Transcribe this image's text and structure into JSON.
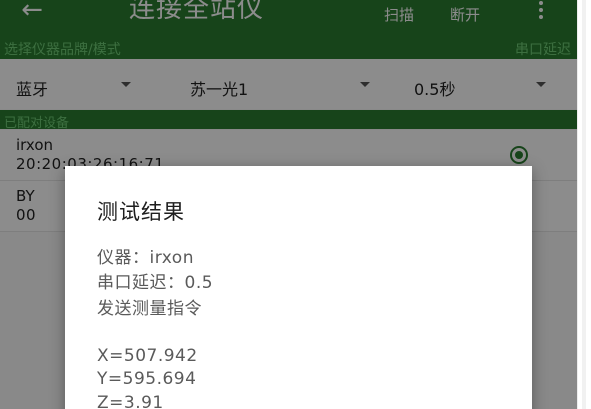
{
  "appbar": {
    "title": "连接全站仪",
    "scan_label": "扫描",
    "disconnect_label": "断开"
  },
  "subheader": {
    "left_label": "选择仪器品牌/模式",
    "right_label": "串口延迟"
  },
  "selectors": {
    "connection": "蓝牙",
    "model": "苏一光1",
    "delay": "0.5秒"
  },
  "paired_header": "已配对设备",
  "devices": [
    {
      "name": "irxon",
      "address": "20:20:03:26:16:71",
      "selected": true
    },
    {
      "name": "BY",
      "address": "00",
      "selected": false
    }
  ],
  "dialog": {
    "title": "测试结果",
    "instrument": "仪器：irxon",
    "delay": "串口延迟：0.5",
    "command": "发送测量指令",
    "x": "X=507.942",
    "y": "Y=595.694",
    "z": "Z=3.91"
  },
  "colors": {
    "primary": "#2a7d31",
    "subtext": "#6fcb76"
  }
}
